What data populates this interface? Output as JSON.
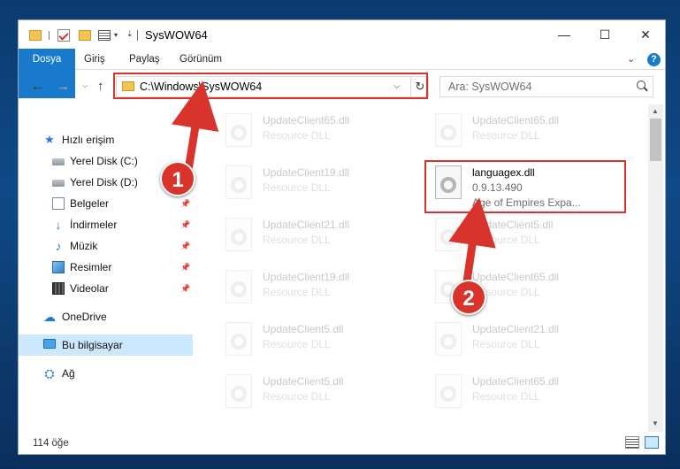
{
  "window": {
    "title": "SysWOW64",
    "controls": {
      "minimize": "—",
      "maximize": "☐",
      "close": "✕"
    }
  },
  "ribbon": {
    "tabs": [
      "Dosya",
      "Giriş",
      "Paylaş",
      "Görünüm"
    ],
    "active_tab": "Dosya",
    "help": "?"
  },
  "address": {
    "path": "C:\\Windows\\SysWOW64",
    "dropdown": "⌵",
    "refresh": "↻"
  },
  "search": {
    "placeholder": "Ara: SysWOW64"
  },
  "nav_buttons": {
    "back": "←",
    "forward": "→",
    "recent": "⌵",
    "up": "↑"
  },
  "sidebar": {
    "items": [
      {
        "label": "Hızlı erişim",
        "icon": "star-icon",
        "glyph": "★"
      },
      {
        "label": "Yerel Disk (C:)",
        "icon": "drive-icon",
        "glyph": ""
      },
      {
        "label": "Yerel Disk (D:)",
        "icon": "drive-icon",
        "glyph": ""
      },
      {
        "label": "Belgeler",
        "icon": "documents-icon",
        "glyph": "",
        "pinned": true
      },
      {
        "label": "İndirmeler",
        "icon": "download-icon",
        "glyph": "↓",
        "pinned": true
      },
      {
        "label": "Müzik",
        "icon": "music-icon",
        "glyph": "♪",
        "pinned": true
      },
      {
        "label": "Resimler",
        "icon": "pictures-icon",
        "glyph": "",
        "pinned": true
      },
      {
        "label": "Videolar",
        "icon": "videos-icon",
        "glyph": "",
        "pinned": true
      },
      {
        "label": "OneDrive",
        "icon": "cloud-icon",
        "glyph": "☁"
      },
      {
        "label": "Bu bilgisayar",
        "icon": "computer-icon",
        "glyph": "",
        "selected": true
      },
      {
        "label": "Ağ",
        "icon": "network-icon",
        "glyph": "⛭"
      }
    ],
    "pin_glyph": "📌"
  },
  "files": [
    {
      "name": "UpdateClient65.dll",
      "desc": "Resource DLL",
      "faded": true
    },
    {
      "name": "UpdateClient65.dll",
      "desc": "Resource DLL",
      "faded": true
    },
    {
      "name": "UpdateClient19.dll",
      "desc": "Resource DLL",
      "faded": true
    },
    {
      "name": "languagex.dll",
      "desc": "0.9.13.490",
      "extra": "Age of Empires Expa...",
      "faded": false
    },
    {
      "name": "UpdateClient21.dll",
      "desc": "Resource DLL",
      "faded": true
    },
    {
      "name": "UpdateClient5.dll",
      "desc": "Resource DLL",
      "faded": true
    },
    {
      "name": "UpdateClient19.dll",
      "desc": "Resource DLL",
      "faded": true
    },
    {
      "name": "UpdateClient65.dll",
      "desc": "Resource DLL",
      "faded": true
    },
    {
      "name": "UpdateClient5.dll",
      "desc": "Resource DLL",
      "faded": true
    },
    {
      "name": "UpdateClient21.dll",
      "desc": "Resource DLL",
      "faded": true
    },
    {
      "name": "UpdateClient5.dll",
      "desc": "Resource DLL",
      "faded": true
    },
    {
      "name": "UpdateClient65.dll",
      "desc": "Resource DLL",
      "faded": true
    }
  ],
  "status": {
    "count": "114 öğe"
  },
  "annotations": {
    "step1": "1",
    "step2": "2",
    "color": "#d9342b"
  }
}
